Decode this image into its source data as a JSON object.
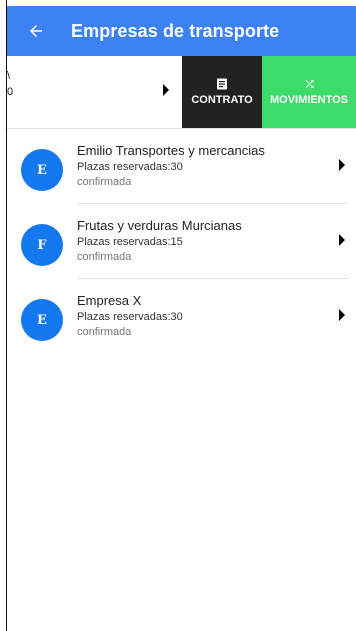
{
  "header": {
    "title": "Empresas de transporte",
    "back_icon": "arrow-left-icon",
    "background": "#3d82f5"
  },
  "swiped_item": {
    "line1": "\\",
    "line2": "0",
    "actions": [
      {
        "label": "CONTRATO",
        "icon": "document-icon",
        "color": "#222222"
      },
      {
        "label": "MOVIMIENTOS",
        "icon": "shuffle-icon",
        "color": "#3ddb6a"
      }
    ]
  },
  "companies": [
    {
      "initial": "E",
      "name": "Emilio Transportes y mercancias",
      "seats": "Plazas reservadas:30",
      "status": "confirmada"
    },
    {
      "initial": "F",
      "name": "Frutas y verduras Murcianas",
      "seats": "Plazas reservadas:15",
      "status": "confirmada"
    },
    {
      "initial": "E",
      "name": "Empresa X",
      "seats": "Plazas reservadas:30",
      "status": "confirmada"
    }
  ],
  "avatar_color": "#1478f0"
}
